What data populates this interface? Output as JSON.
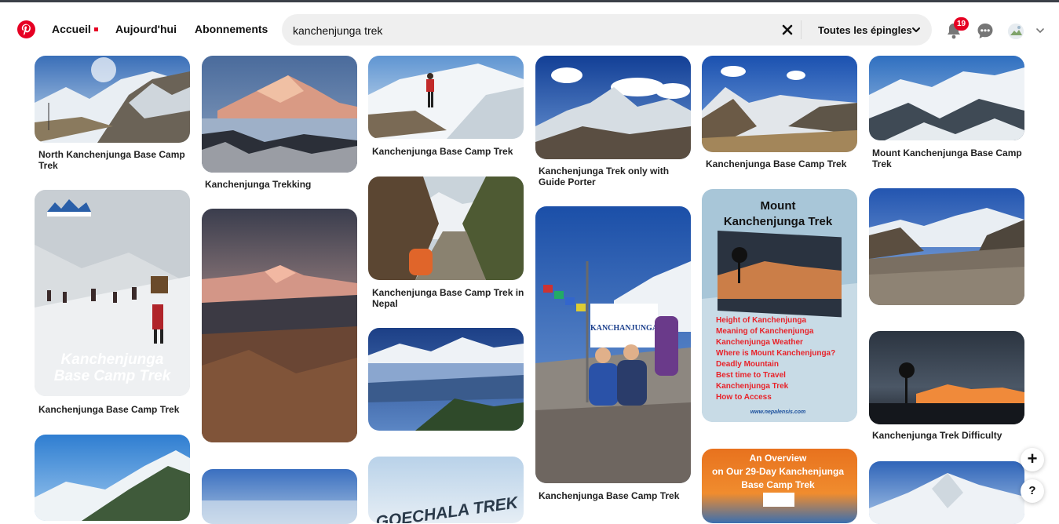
{
  "header": {
    "nav": {
      "home": "Accueil",
      "today": "Aujourd'hui",
      "subscriptions": "Abonnements"
    },
    "search": {
      "query": "kanchenjunga trek",
      "filter": "Toutes les épingles"
    },
    "notifications_count": "19",
    "icons": [
      "pinterest-logo",
      "clear-icon",
      "chevron-down-icon",
      "bell-icon",
      "chat-icon",
      "avatar",
      "chevron-down-icon"
    ]
  },
  "pins": [
    {
      "caption": "North Kanchenjunga Base Camp Trek"
    },
    {
      "caption": "Kanchenjunga Trekking"
    },
    {
      "caption": "Kanchenjunga Base Camp Trek"
    },
    {
      "caption": "Kanchenjunga Trek only with Guide Porter"
    },
    {
      "caption": "Kanchenjunga Base Camp Trek"
    },
    {
      "caption": "Mount Kanchenjunga Base Camp Trek"
    },
    {
      "caption": "Kanchenjunga Base Camp Trek"
    },
    {
      "caption": "Kanchenjunga Base Camp Trek in Nepal"
    },
    {
      "caption": "Kanchenjunga Base Camp Trek"
    },
    {
      "caption": "Kanchenjunga Trek Difficulty"
    }
  ],
  "pin_overlays": {
    "kbct_text": "Kanchenjunga Base Camp Trek",
    "mount_title": "Mount Kanchenjunga Trek",
    "mount_list": [
      "Height of Kanchenjunga",
      "Meaning of Kanchenjunga",
      "Kanchenjunga Weather",
      "Where is Mount Kanchenjunga?",
      "Deadly Mountain",
      "Best time to Travel",
      "Kanchenjunga Trek",
      "How to Access"
    ],
    "mount_url": "www.nepalensis.com",
    "sign_text": "KANCHANJUNGA",
    "overview_text": "An Overview on Our 29-Day Kanchenjunga Base Camp Trek",
    "goechala_text": "GOECHALA TREK"
  },
  "fabs": {
    "plus": "+",
    "help": "?"
  },
  "colors": {
    "brand": "#e60023"
  }
}
